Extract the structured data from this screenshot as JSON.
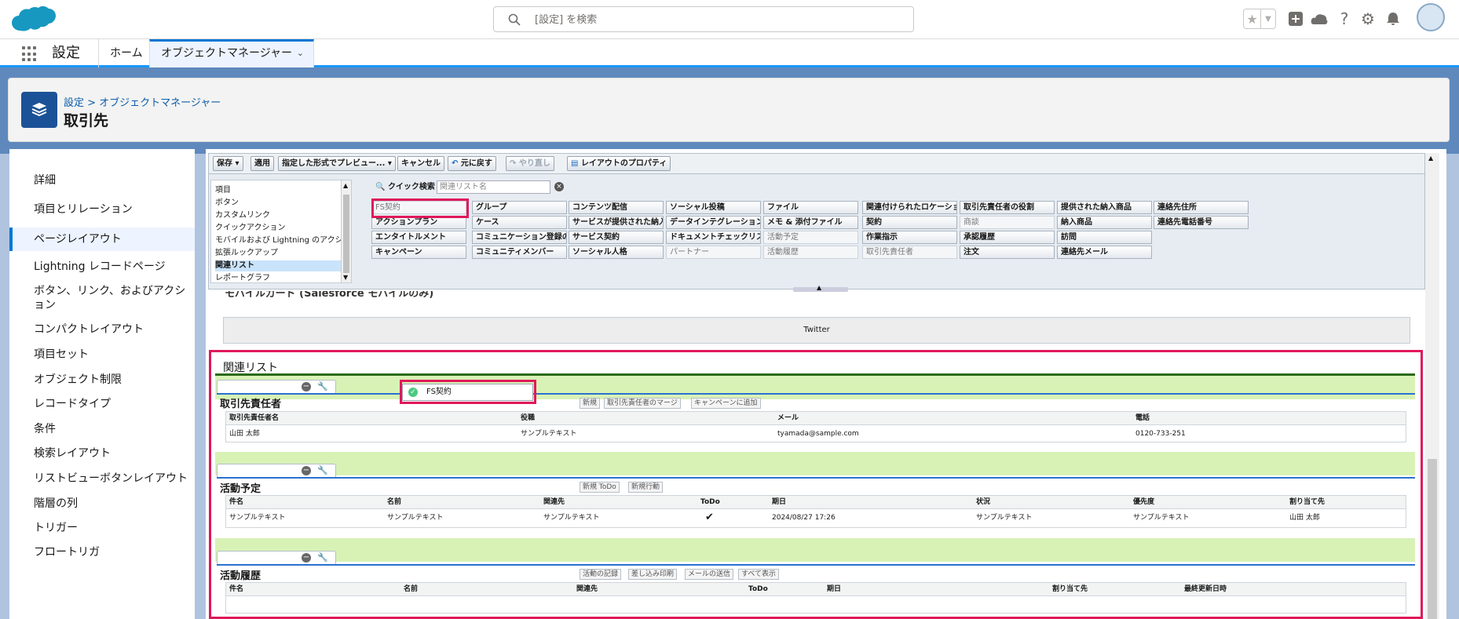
{
  "search": {
    "placeholder": "[設定] を検索"
  },
  "nav": {
    "app_name": "設定",
    "home_tab": "ホーム",
    "om_tab": "オブジェクトマネージャー"
  },
  "header": {
    "breadcrumb": "設定 > オブジェクトマネージャー",
    "title": "取引先"
  },
  "sidebar": {
    "items": [
      {
        "label": "詳細"
      },
      {
        "label": "項目とリレーション"
      },
      {
        "label": "ページレイアウト",
        "active": true
      },
      {
        "label": "Lightning レコードページ"
      },
      {
        "label": "ボタン、リンク、およびアクション"
      },
      {
        "label": "コンパクトレイアウト"
      },
      {
        "label": "項目セット"
      },
      {
        "label": "オブジェクト制限"
      },
      {
        "label": "レコードタイプ"
      },
      {
        "label": "条件"
      },
      {
        "label": "検索レイアウト"
      },
      {
        "label": "リストビューボタンレイアウト"
      },
      {
        "label": "階層の列"
      },
      {
        "label": "トリガー"
      },
      {
        "label": "フロートリガ"
      }
    ]
  },
  "toolbar": {
    "save": "保存",
    "apply": "適用",
    "preview": "指定した形式でプレビュー...",
    "cancel": "キャンセル",
    "undo": "元に戻す",
    "redo": "やり直し",
    "properties": "レイアウトのプロパティ"
  },
  "palette": {
    "categories": [
      "項目",
      "ボタン",
      "カスタムリンク",
      "クイックアクション",
      "モバイルおよび Lightning のアクション",
      "拡張ルックアップ",
      "関連リスト",
      "レポートグラフ"
    ],
    "selected_category": "関連リスト",
    "quick_find_label": "クイック検索",
    "quick_find_placeholder": "関連リスト名",
    "items": [
      [
        "FS契約",
        "グループ",
        "コンテンツ配信",
        "ソーシャル投稿",
        "ファイル",
        "関連付けられたロケーション",
        "取引先責任者の役割",
        "提供された納入商品",
        "連絡先住所"
      ],
      [
        "アクションプラン",
        "ケース",
        "サービスが提供された納入商品",
        "データインテグレーションルール",
        "メモ & 添付ファイル",
        "契約",
        "商談",
        "納入商品",
        "連絡先電話番号"
      ],
      [
        "エンタイトルメント",
        "コミュニケーション登録の同意",
        "サービス契約",
        "ドキュメントチェックリスト項目",
        "活動予定",
        "作業指示",
        "承認履歴",
        "訪問"
      ],
      [
        "キャンペーン",
        "コミュニティメンバー",
        "ソーシャル人格",
        "パートナー",
        "活動履歴",
        "取引先責任者",
        "注文",
        "連絡先メール"
      ]
    ],
    "used_items": [
      "FS契約",
      "商談",
      "活動予定",
      "パートナー",
      "活動履歴",
      "取引先責任者"
    ]
  },
  "mobile_card": {
    "label": "モバイルカード (Salesforce モバイルのみ)",
    "item": "Twitter"
  },
  "related": {
    "title": "関連リスト",
    "dragging": "FS契約",
    "lists": [
      {
        "title": "取引先責任者",
        "buttons": [
          "新規",
          "取引先責任者のマージ",
          "キャンペーンに追加"
        ],
        "headers": [
          "取引先責任者名",
          "役職",
          "メール",
          "電話"
        ],
        "row": [
          "山田 太郎",
          "サンプルテキスト",
          "tyamada@sample.com",
          "0120-733-251"
        ]
      },
      {
        "title": "活動予定",
        "buttons": [
          "新規 ToDo",
          "新規行動"
        ],
        "headers": [
          "件名",
          "名前",
          "関連先",
          "ToDo",
          "期日",
          "状況",
          "優先度",
          "割り当て先"
        ],
        "row": [
          "サンプルテキスト",
          "サンプルテキスト",
          "サンプルテキスト",
          "✔",
          "2024/08/27 17:26",
          "サンプルテキスト",
          "サンプルテキスト",
          "山田 太郎"
        ]
      },
      {
        "title": "活動履歴",
        "buttons": [
          "活動の記録",
          "差し込み印刷",
          "メールの送信",
          "すべて表示"
        ],
        "headers": [
          "件名",
          "名前",
          "関連先",
          "ToDo",
          "期日",
          "割り当て先",
          "最終更新日時"
        ]
      }
    ]
  },
  "colors": {
    "accent": "#0176d3",
    "highlight": "#e0185a",
    "band": "#d8f2b6"
  }
}
